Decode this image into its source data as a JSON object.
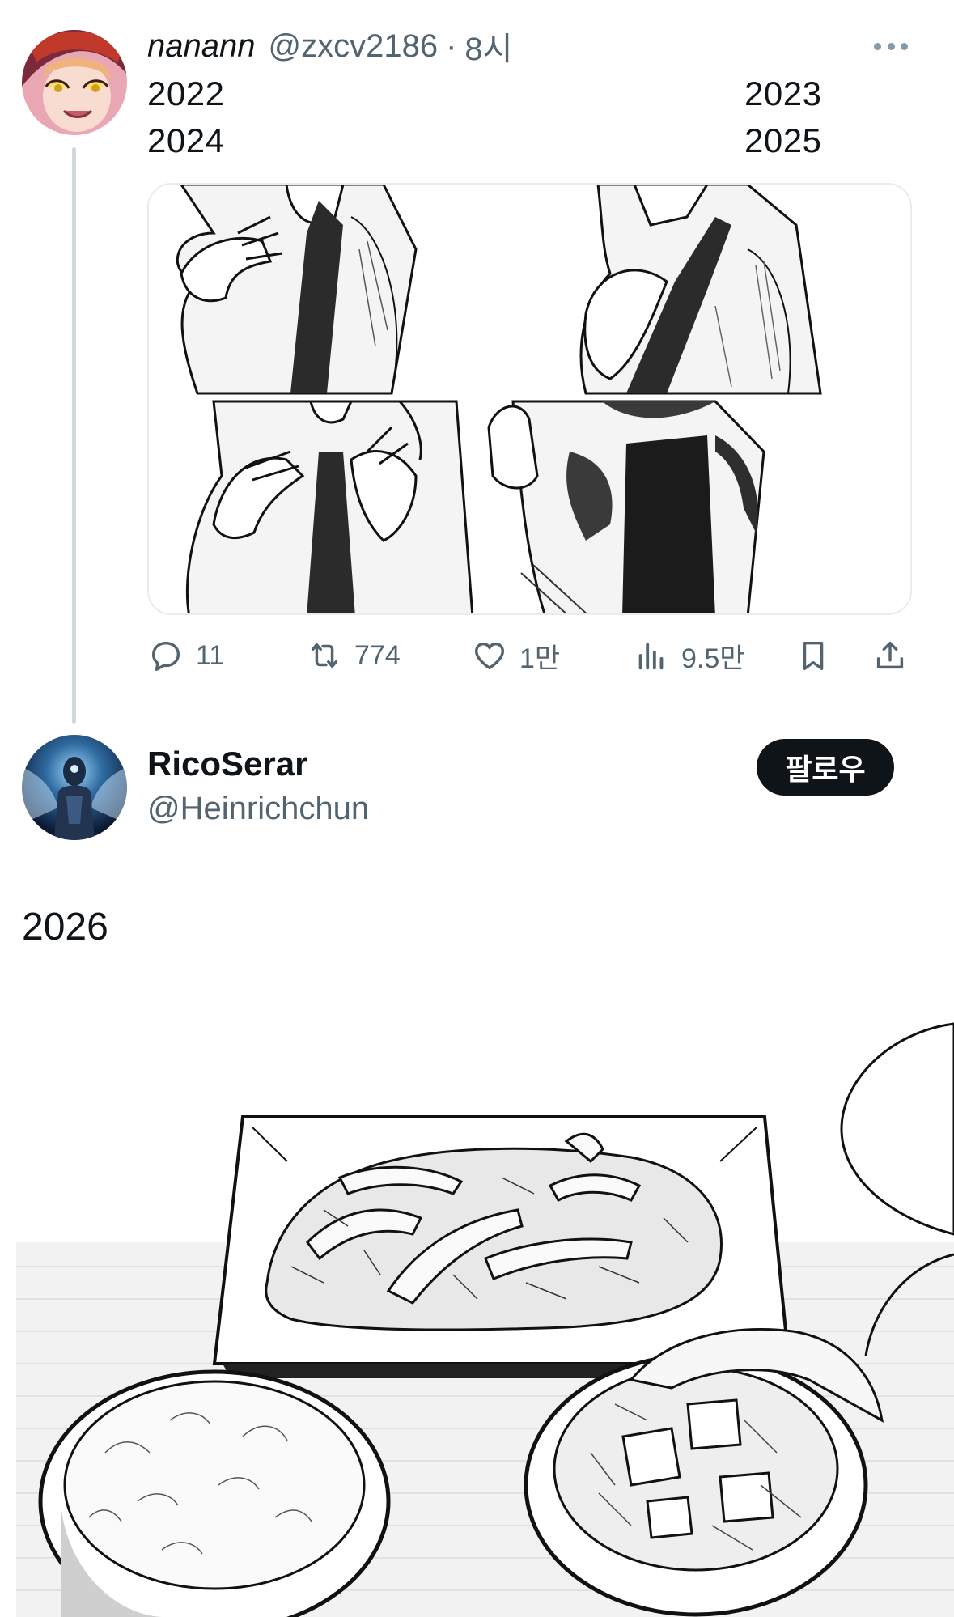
{
  "tweet1": {
    "display_name": "nanann",
    "handle": "@zxcv2186",
    "separator": "·",
    "time": "8시",
    "year_labels": {
      "top_left": "2022",
      "top_right": "2023",
      "bottom_left": "2024",
      "bottom_right": "2025"
    },
    "media_description_icon": "manga-panel-grid-image",
    "actions": {
      "reply_count": "11",
      "retweet_count": "774",
      "like_count": "1만",
      "view_count": "9.5만"
    }
  },
  "tweet2": {
    "display_name": "RicoSerar",
    "handle": "@Heinrichchun",
    "follow_label": "팔로우",
    "text": "2026",
    "media_description_icon": "manga-meal-image"
  },
  "colors": {
    "text_primary": "#0f1419",
    "text_secondary": "#536471",
    "thread_line": "#cfd9de",
    "border": "#e6ecf0",
    "follow_button_bg": "#0f1419"
  }
}
